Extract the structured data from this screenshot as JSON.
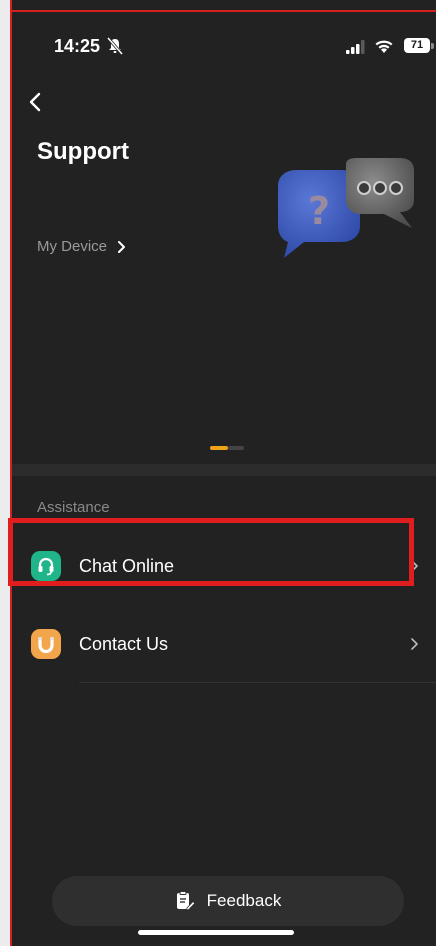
{
  "status_bar": {
    "time": "14:25",
    "battery": "71"
  },
  "header": {
    "title": "Support",
    "my_device": "My Device"
  },
  "assistance": {
    "section_label": "Assistance",
    "items": [
      {
        "label": "Chat Online",
        "icon": "headset-icon"
      },
      {
        "label": "Contact Us",
        "icon": "magnet-icon"
      }
    ]
  },
  "footer": {
    "feedback_label": "Feedback"
  },
  "colors": {
    "accent": "#f0a21a",
    "chat_icon_bg": "#1fb489",
    "contact_icon_bg": "#f2a54a",
    "highlight": "#e01e1e"
  }
}
